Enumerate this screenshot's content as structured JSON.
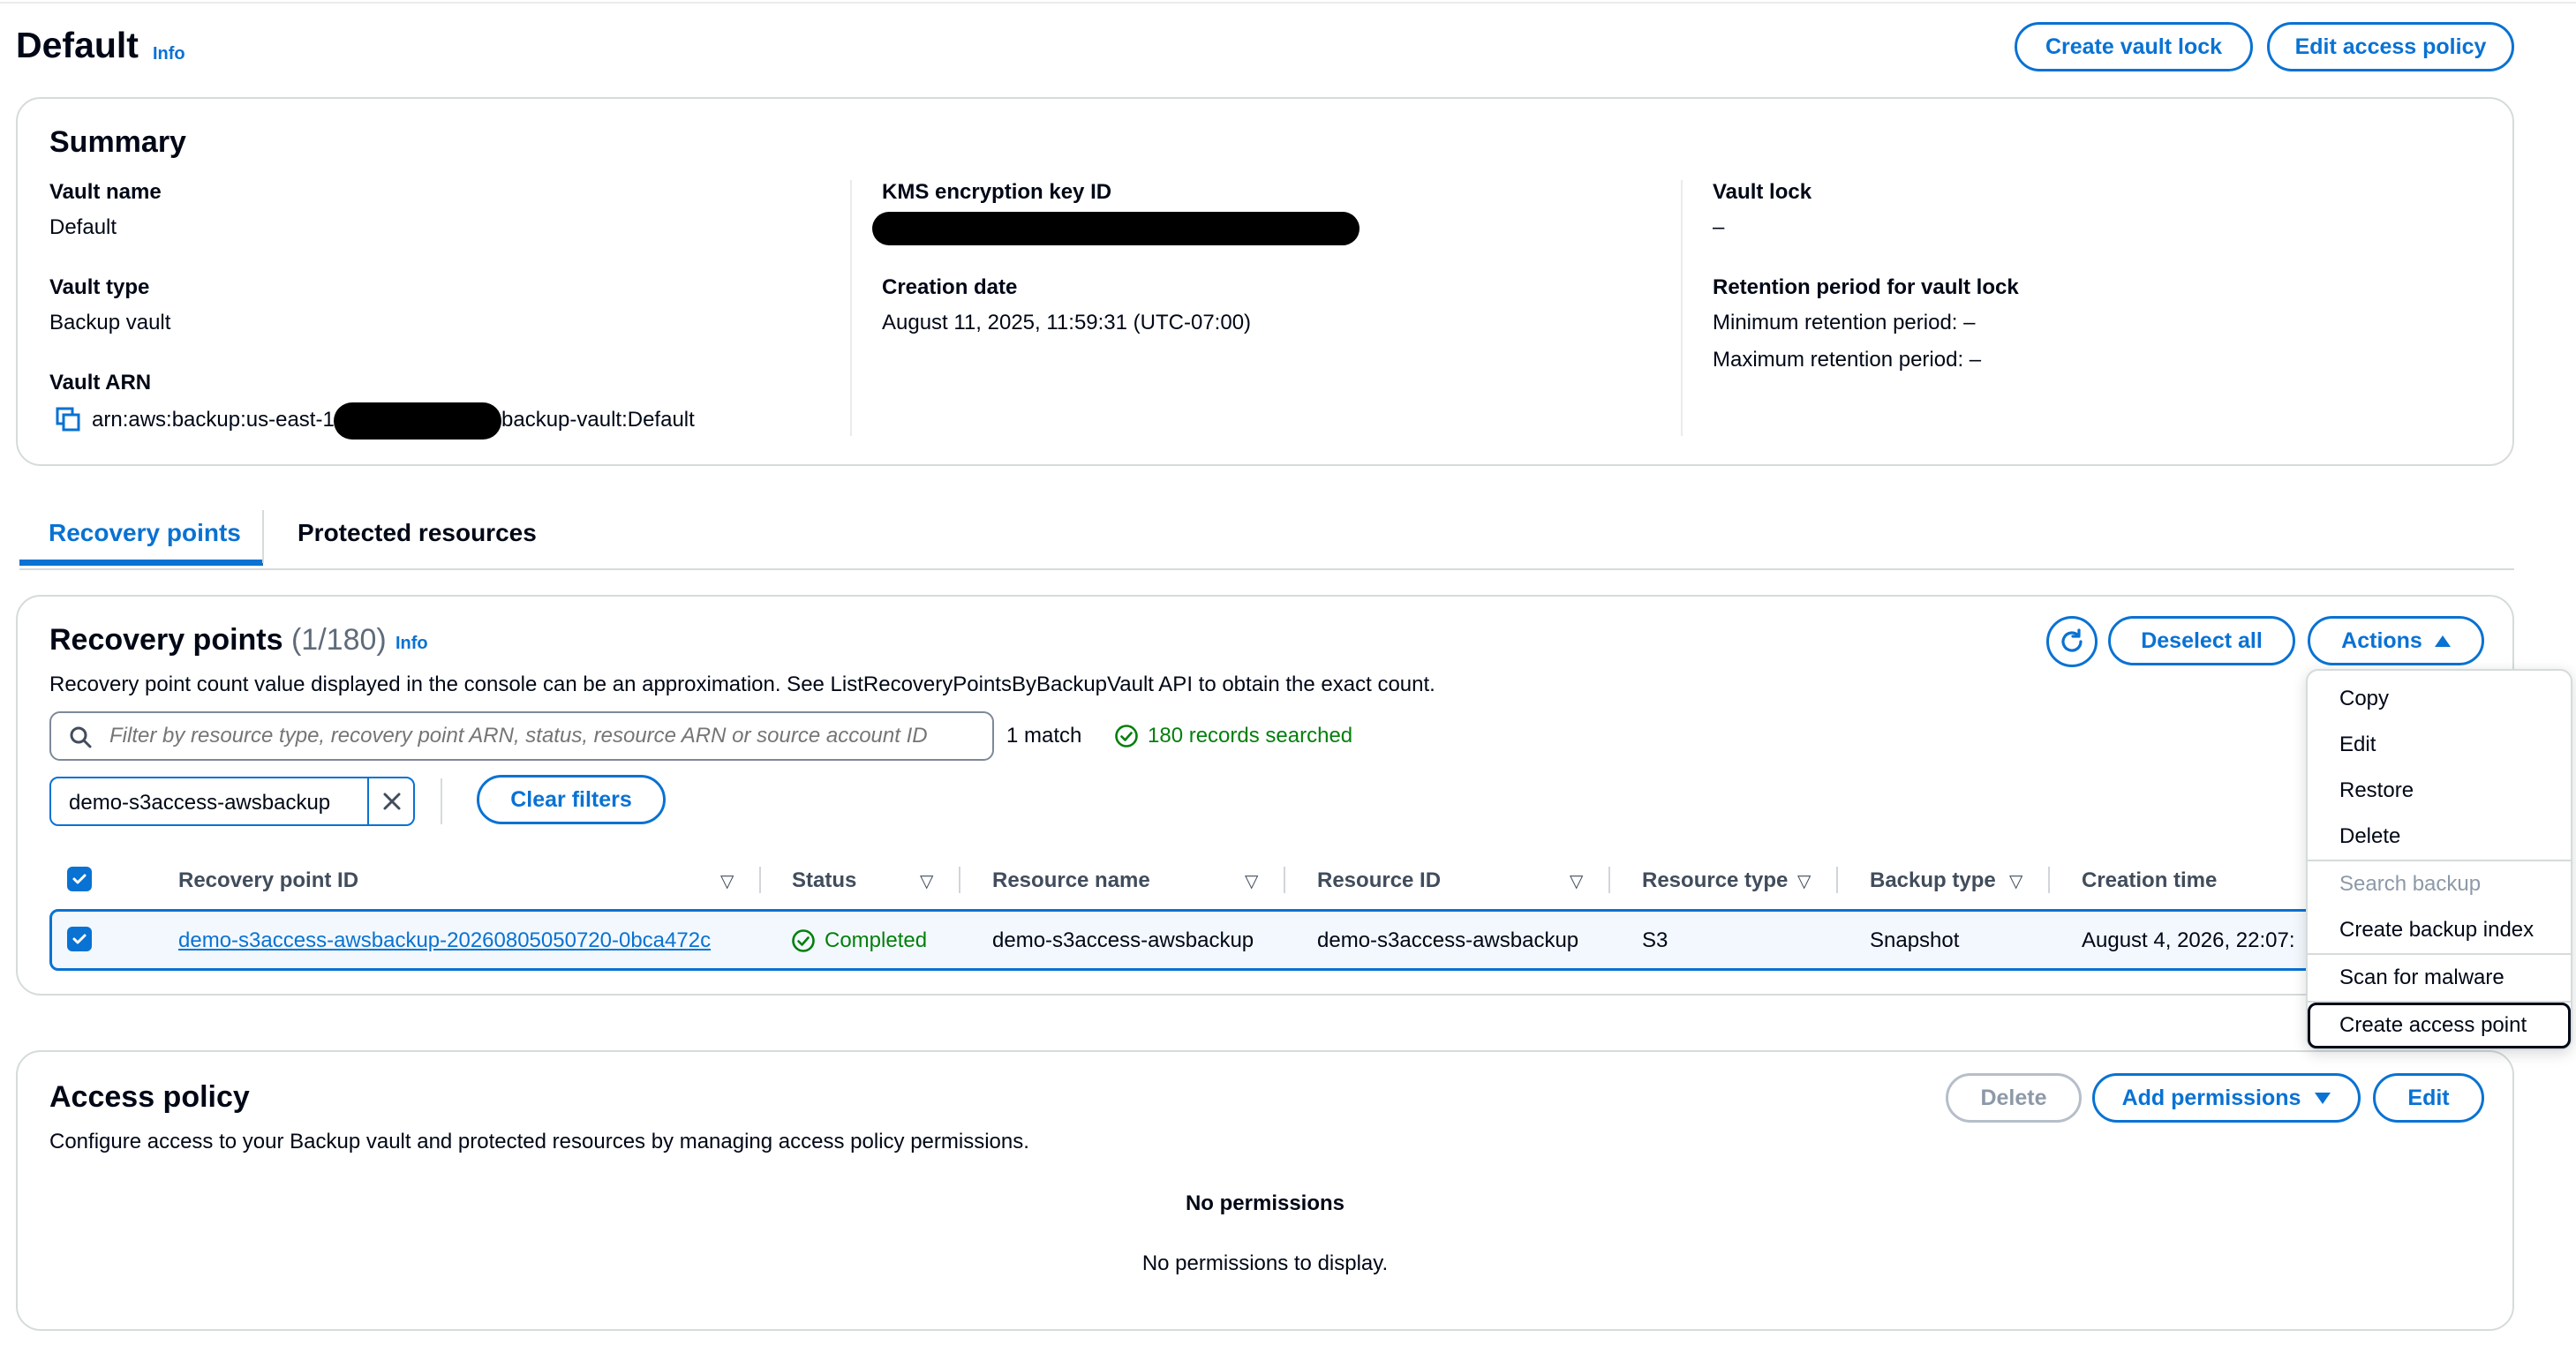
{
  "page": {
    "title": "Default",
    "info": "Info",
    "create_vault_lock": "Create vault lock",
    "edit_access_policy": "Edit access policy"
  },
  "summary": {
    "title": "Summary",
    "vault_name_label": "Vault name",
    "vault_name": "Default",
    "vault_type_label": "Vault type",
    "vault_type": "Backup vault",
    "vault_arn_label": "Vault ARN",
    "vault_arn_prefix": "arn:aws:backup:us-east-1",
    "vault_arn_suffix": "backup-vault:Default",
    "kms_label": "KMS encryption key ID",
    "creation_date_label": "Creation date",
    "creation_date": "August 11, 2025, 11:59:31 (UTC-07:00)",
    "vault_lock_label": "Vault lock",
    "vault_lock": "–",
    "retention_label": "Retention period for vault lock",
    "min_retention": "Minimum retention period: –",
    "max_retention": "Maximum retention period: –"
  },
  "tabs": [
    {
      "label": "Recovery points",
      "active": true
    },
    {
      "label": "Protected resources",
      "active": false
    }
  ],
  "recovery_points": {
    "title": "Recovery points",
    "count": "(1/180)",
    "info": "Info",
    "description": "Recovery point count value displayed in the console can be an approximation. See ListRecoveryPointsByBackupVault API to obtain the exact count.",
    "search_placeholder": "Filter by resource type, recovery point ARN, status, resource ARN or source account ID",
    "match_text": "1 match",
    "records_text": "180 records searched",
    "filter_chip": "demo-s3access-awsbackup",
    "clear_filters": "Clear filters",
    "deselect_all": "Deselect all",
    "actions": "Actions",
    "columns": [
      "Recovery point ID",
      "Status",
      "Resource name",
      "Resource ID",
      "Resource type",
      "Backup type",
      "Creation time"
    ],
    "rows": [
      {
        "id": "demo-s3access-awsbackup-20260805050720-0bca472c",
        "status": "Completed",
        "resource_name": "demo-s3access-awsbackup",
        "resource_id": "demo-s3access-awsbackup",
        "resource_type": "S3",
        "backup_type": "Snapshot",
        "creation_time": "August 4, 2026, 22:07:"
      }
    ]
  },
  "actions_menu": {
    "items": [
      {
        "label": "Copy"
      },
      {
        "label": "Edit"
      },
      {
        "label": "Restore"
      },
      {
        "label": "Delete"
      },
      {
        "label": "Search backup"
      },
      {
        "label": "Create backup index"
      },
      {
        "label": "Scan for malware"
      },
      {
        "label": "Create access point"
      }
    ]
  },
  "access_policy": {
    "title": "Access policy",
    "description": "Configure access to your Backup vault and protected resources by managing access policy permissions.",
    "delete": "Delete",
    "add_permissions": "Add permissions",
    "edit": "Edit",
    "empty_title": "No permissions",
    "empty_text": "No permissions to display."
  },
  "colors": {
    "accent": "#0972d3",
    "success": "#037f0c",
    "text": "#000716",
    "border": "#d5dbdb"
  }
}
